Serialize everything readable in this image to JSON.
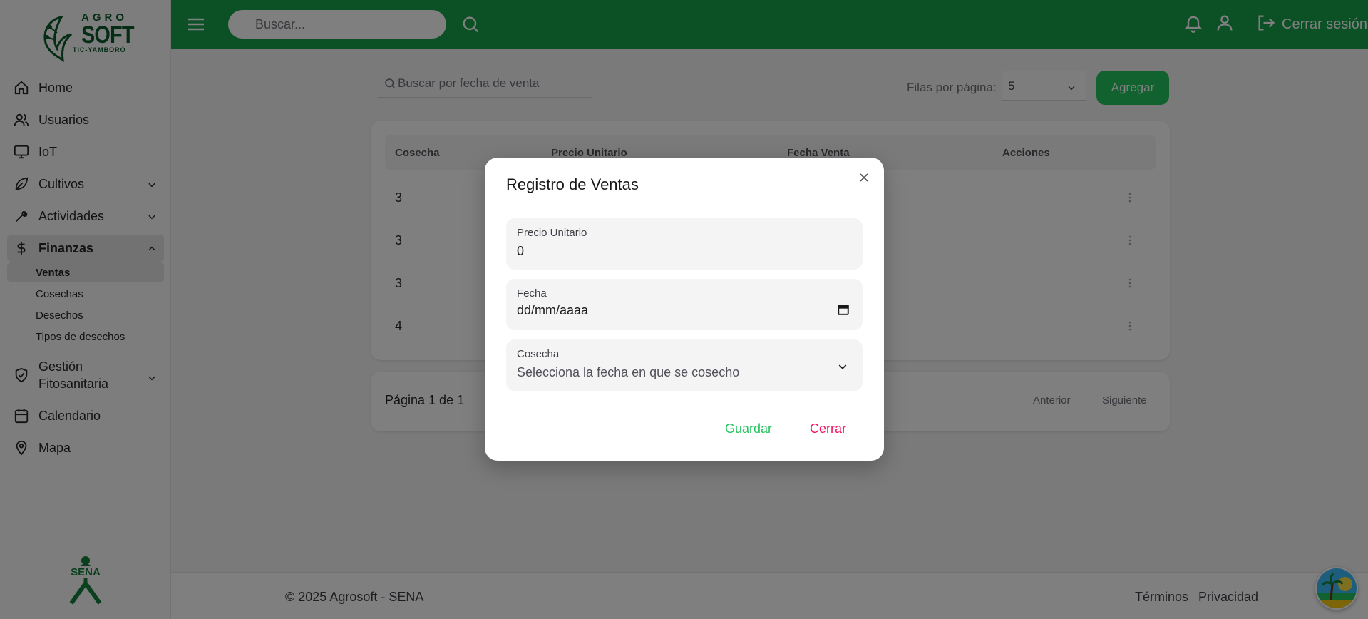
{
  "app": {
    "logo_top": "AGRO",
    "logo_main": "SOFT",
    "logo_sub": "TIC-YAMBORÓ"
  },
  "sidebar": {
    "items": [
      {
        "label": "Home",
        "icon": "home-icon"
      },
      {
        "label": "Usuarios",
        "icon": "users-icon"
      },
      {
        "label": "IoT",
        "icon": "monitor-icon"
      },
      {
        "label": "Cultivos",
        "icon": "leaf-icon"
      },
      {
        "label": "Actividades",
        "icon": "wrench-icon"
      },
      {
        "label": "Finanzas",
        "icon": "dollar-icon"
      },
      {
        "label": "Gestión Fitosanitaria",
        "icon": "shield-check-icon"
      },
      {
        "label": "Calendario",
        "icon": "calendar-icon"
      },
      {
        "label": "Mapa",
        "icon": "map-pin-icon"
      }
    ],
    "finanzas_sub": [
      "Ventas",
      "Cosechas",
      "Desechos",
      "Tipos de desechos"
    ],
    "gestion_line1": "Gestión",
    "gestion_line2": "Fitosanitaria",
    "bottom_logo": "SENA"
  },
  "topbar": {
    "search_placeholder": "Buscar...",
    "logout_label": "Cerrar sesión"
  },
  "toolbar": {
    "search_placeholder": "Buscar por fecha de venta",
    "rows_label": "Filas por página:",
    "rows_value": "5",
    "add_label": "Agregar"
  },
  "table": {
    "headers": [
      "Cosecha",
      "Precio Unitario",
      "Fecha Venta",
      "Acciones"
    ],
    "rows": [
      {
        "cosecha": "3"
      },
      {
        "cosecha": "3"
      },
      {
        "cosecha": "3"
      },
      {
        "cosecha": "4"
      }
    ]
  },
  "pagination": {
    "info": "Página 1 de 1",
    "prev": "Anterior",
    "next": "Siguiente"
  },
  "footer": {
    "copyright": "© 2025 Agrosoft - SENA",
    "terms": "Términos",
    "privacy": "Privacidad"
  },
  "modal": {
    "title": "Registro de Ventas",
    "fields": {
      "precio_label": "Precio Unitario",
      "precio_value": "0",
      "fecha_label": "Fecha",
      "fecha_value": "dd/mm/aaaa",
      "cosecha_label": "Cosecha",
      "cosecha_placeholder": "Selecciona la fecha en que se cosecho"
    },
    "save_label": "Guardar",
    "close_label": "Cerrar"
  },
  "colors": {
    "topbar": "#16a34a",
    "save": "#22c55e",
    "close": "#f31260"
  }
}
